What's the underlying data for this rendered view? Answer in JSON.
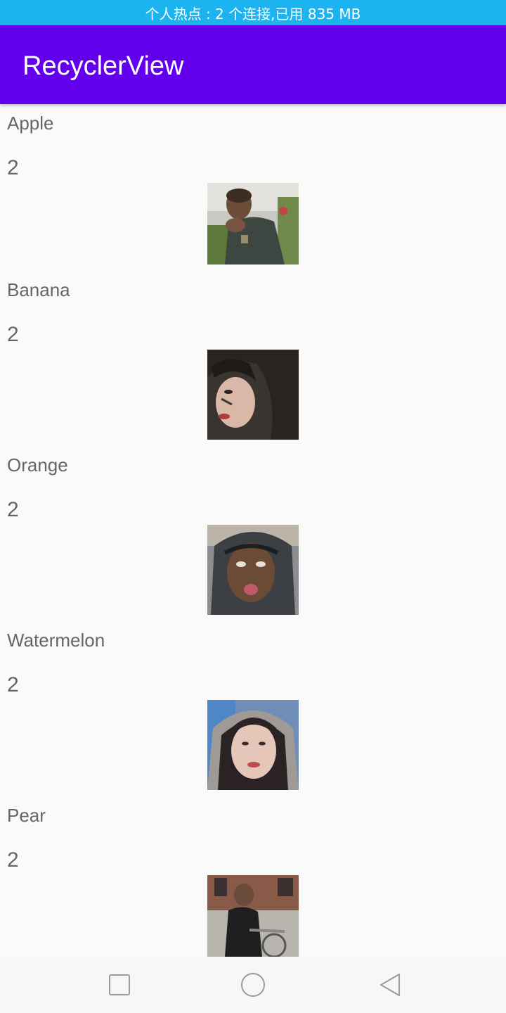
{
  "status_bar": {
    "text": "个人热点 : 2 个连接,已用 835 MB",
    "color": "#1bb4f0"
  },
  "app_bar": {
    "title": "RecyclerView",
    "color": "#6200ee"
  },
  "list": {
    "items": [
      {
        "name": "Apple",
        "count": "2",
        "image_icon": "photo-person-covering-face"
      },
      {
        "name": "Banana",
        "count": "2",
        "image_icon": "photo-woman-profile"
      },
      {
        "name": "Orange",
        "count": "2",
        "image_icon": "photo-man-hood-tongue"
      },
      {
        "name": "Watermelon",
        "count": "2",
        "image_icon": "photo-girl-hood"
      },
      {
        "name": "Pear",
        "count": "2",
        "image_icon": "photo-boy-bicycle"
      }
    ]
  },
  "nav_bar": {
    "recents_icon": "square-icon",
    "home_icon": "circle-icon",
    "back_icon": "triangle-back-icon"
  }
}
